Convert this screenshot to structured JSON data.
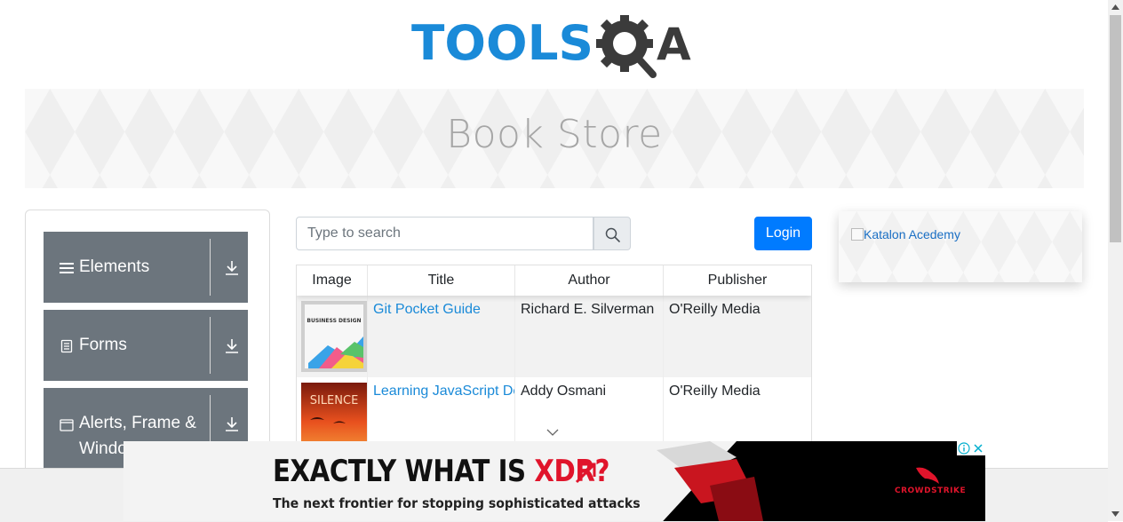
{
  "logo": {
    "part1": "TOOLS",
    "part2": "QA"
  },
  "banner": {
    "title": "Book Store"
  },
  "sidebar": {
    "groups": [
      {
        "label": "Elements",
        "icon": "hamburger-icon"
      },
      {
        "label": "Forms",
        "icon": "document-icon"
      },
      {
        "label": "Alerts, Frame &",
        "label2": "Windows",
        "icon": "window-icon"
      }
    ]
  },
  "search": {
    "placeholder": "Type to search",
    "value": ""
  },
  "login_label": "Login",
  "table": {
    "headers": [
      "Image",
      "Title",
      "Author",
      "Publisher"
    ],
    "rows": [
      {
        "cover_text": "BUSINESS DESIGN",
        "title": "Git Pocket Guide",
        "author": "Richard E. Silverman",
        "publisher": "O'Reilly Media"
      },
      {
        "cover_text": "SILENCE",
        "title": "Learning JavaScript Design Patterns",
        "author": "Addy Osmani",
        "publisher": "O'Reilly Media"
      }
    ]
  },
  "right_ad": {
    "alt": "Katalon Acedemy"
  },
  "bottom_ad": {
    "headline_a": "EXACTLY WHAT IS ",
    "headline_b": "XDR?",
    "sub": "The next frontier for stopping sophisticated attacks",
    "brand": "CROWDSTRIKE"
  },
  "colors": {
    "brand_blue": "#1a8ad8",
    "primary": "#007bff",
    "sidebar_group": "#6c757d",
    "ad_red": "#e0142b"
  }
}
